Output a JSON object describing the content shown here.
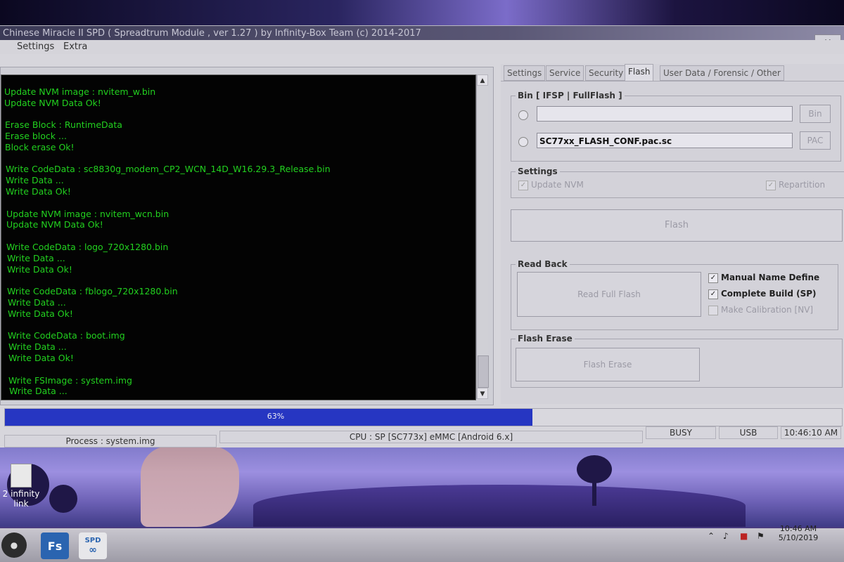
{
  "window": {
    "title": "Chinese Miracle II SPD ( Spreadtrum Module , ver 1.27 ) by Infinity-Box Team (c) 2014-2017",
    "close_label": "×"
  },
  "menu": [
    "Settings",
    "Extra"
  ],
  "log": {
    "lines": [
      "",
      "Update NVM image : nvitem_w.bin",
      "Update NVM Data Ok!",
      "",
      "Erase Block : RuntimeData",
      "Erase block ...",
      "Block erase Ok!",
      "",
      "Write CodeData : sc8830g_modem_CP2_WCN_14D_W16.29.3_Release.bin",
      "Write Data ...",
      "Write Data Ok!",
      "",
      "Update NVM image : nvitem_wcn.bin",
      "Update NVM Data Ok!",
      "",
      "Write CodeData : logo_720x1280.bin",
      "Write Data ...",
      "Write Data Ok!",
      "",
      "Write CodeData : fblogo_720x1280.bin",
      "Write Data ...",
      "Write Data Ok!",
      "",
      "Write CodeData : boot.img",
      "Write Data ...",
      "Write Data Ok!",
      "",
      "Write FSImage : system.img",
      "Write Data ..."
    ],
    "scroll_up_icon": "up-arrow-icon",
    "scroll_down_icon": "down-arrow-icon"
  },
  "tabs": [
    {
      "label": "Settings",
      "active": false
    },
    {
      "label": "Service",
      "active": false
    },
    {
      "label": "Security",
      "active": false
    },
    {
      "label": "Flash",
      "active": true
    },
    {
      "label": "User Data / Forensic / Other",
      "active": false
    }
  ],
  "flash": {
    "bin_group": {
      "title": "Bin  [ IFSP | FullFlash ]",
      "bin_value": "",
      "bin_button": "Bin",
      "pac_value": "SC77xx_FLASH_CONF.pac.sc",
      "pac_button": "PAC"
    },
    "settings_group": {
      "title": "Settings",
      "update_nvm": {
        "label": "Update NVM",
        "checked": true
      },
      "repartition": {
        "label": "Repartition",
        "checked": true
      }
    },
    "flash_button": "Flash",
    "readback_group": {
      "title": "Read Back",
      "read_full_flash_button": "Read Full Flash",
      "manual_name_define": {
        "label": "Manual Name Define",
        "checked": true
      },
      "complete_build": {
        "label": "Complete Build (SP)",
        "checked": true
      },
      "make_calibration": {
        "label": "Make Calibration [NV]",
        "checked": false
      }
    },
    "erase_group": {
      "title": "Flash Erase",
      "flash_erase_button": "Flash Erase"
    }
  },
  "progress": {
    "percent": 63,
    "label": "63%",
    "fill_color": "#2636c2"
  },
  "status": {
    "process": "Process : system.img",
    "cpu": "CPU : SP [SC773x] eMMC [Android 6.x]",
    "busy": "BUSY",
    "usb": "USB",
    "time": "10:46:10 AM"
  },
  "desktop": {
    "icon_label_1": "2 infinity",
    "icon_label_2": "link"
  },
  "taskbar": {
    "media_icon": "film-reel-icon",
    "fs_label": "Fs",
    "spd_label": "SPD",
    "clock_time": "10:46 AM",
    "clock_date": "5/10/2019"
  }
}
